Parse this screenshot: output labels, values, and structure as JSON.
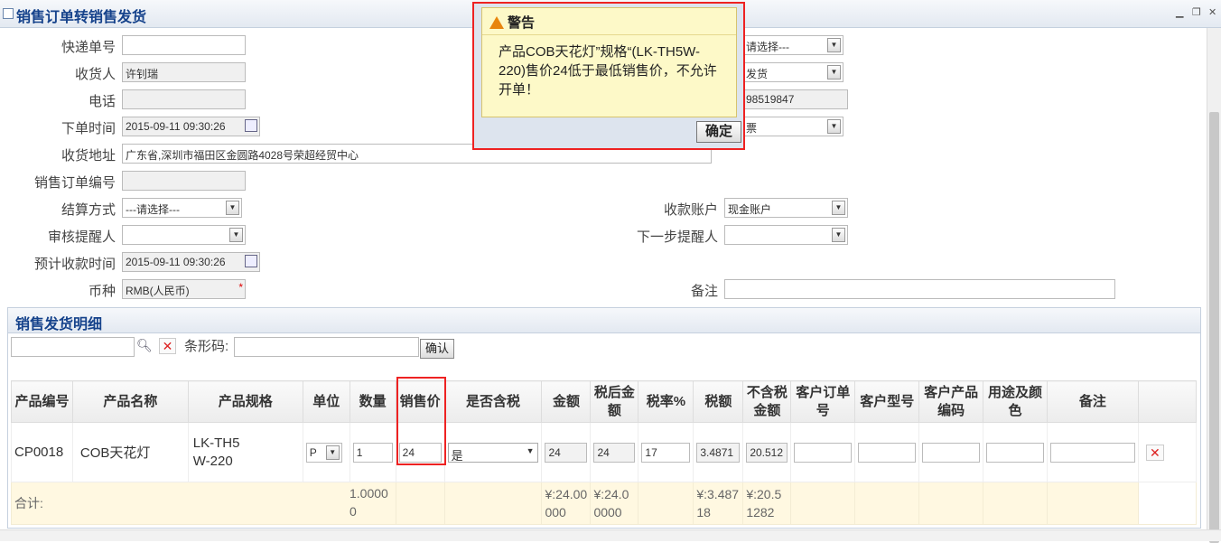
{
  "window": {
    "title": "销售订单转销售发货"
  },
  "form": {
    "express_no_label": "快递单号",
    "express_no": "",
    "receiver_label": "收货人",
    "receiver": "许钊瑞",
    "phone_label": "电话",
    "phone": "",
    "order_time_label": "下单时间",
    "order_time": "2015-09-11 09:30:26",
    "address_label": "收货地址",
    "address": "广东省,深圳市福田区金圆路4028号荣超经贸中心",
    "so_no_label": "销售订单编号",
    "so_no": "",
    "settle_label": "结算方式",
    "settle": "---请选择---",
    "reviewer_label": "审核提醒人",
    "reviewer": "",
    "expect_label": "预计收款时间",
    "expect": "2015-09-11 09:30:26",
    "currency_label": "币种",
    "currency": "RMB(人民币)",
    "right_sel1": "请选择---",
    "right_sel2": "发货",
    "right_phone": "98519847",
    "right_sel3": "票",
    "account_label": "收款账户",
    "account": "现金账户",
    "next_label": "下一步提醒人",
    "next": "",
    "remark_label": "备注",
    "remark": ""
  },
  "detail": {
    "title": "销售发货明细",
    "barcode_label": "条形码:",
    "confirm": "确认",
    "headers": [
      "产品编号",
      "产品名称",
      "产品规格",
      "单位",
      "数量",
      "销售价",
      "是否含税",
      "金额",
      "税后金额",
      "税率%",
      "税额",
      "不含税金额",
      "客户订单号",
      "客户型号",
      "客户产品编码",
      "用途及颜色",
      "备注"
    ],
    "row": {
      "code": "CP0018",
      "name": "COB天花灯",
      "spec": "LK-TH5W-220",
      "unit": "P",
      "qty": "1",
      "price": "24",
      "tax_incl": "是",
      "amount": "24",
      "after_tax": "24",
      "rate": "17",
      "tax": "3.4871",
      "ex_tax": "20.512"
    },
    "sum": {
      "label": "合计:",
      "qty": "1.00000",
      "amount": "¥:24.00000",
      "after_tax": "¥:24.00000",
      "tax": "¥:3.48718",
      "ex_tax": "¥:20.51282"
    }
  },
  "dialog": {
    "title": "警告",
    "message": "产品COB天花灯”规格“(LK-TH5W-220)售价24低于最低销售价，不允许开单！",
    "ok": "确定"
  }
}
